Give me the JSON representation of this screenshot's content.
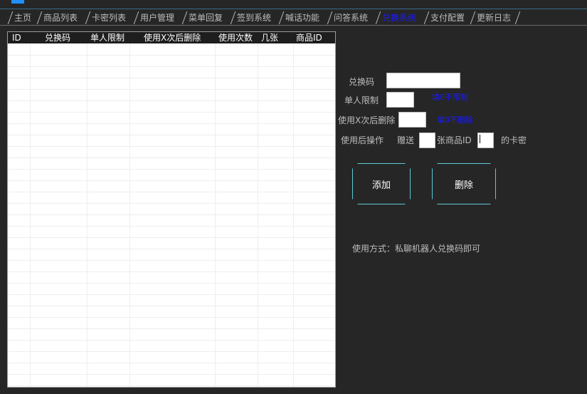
{
  "tabs": [
    {
      "label": "主页"
    },
    {
      "label": "商品列表"
    },
    {
      "label": "卡密列表"
    },
    {
      "label": "用户管理"
    },
    {
      "label": "菜单回复"
    },
    {
      "label": "签到系统"
    },
    {
      "label": "喊话功能"
    },
    {
      "label": "问答系统"
    },
    {
      "label": "兑换系统",
      "active": true
    },
    {
      "label": "支付配置"
    },
    {
      "label": "更新日志"
    }
  ],
  "table": {
    "columns": [
      "ID",
      "兑换码",
      "单人限制",
      "使用X次后删除",
      "使用次数",
      "几张",
      "商品ID"
    ],
    "rows": []
  },
  "form": {
    "code_label": "兑换码",
    "code_value": "",
    "limit_label": "单人限制",
    "limit_value": "",
    "limit_hint": "填0不限制",
    "delete_after_label": "使用X次后删除",
    "delete_after_value": "",
    "delete_after_hint": "填0不删除",
    "after_use_label": "使用后操作",
    "gift_label": "赠送",
    "gift_value": "",
    "goods_label": "张商品ID",
    "goods_value": "",
    "card_label": "的卡密"
  },
  "buttons": {
    "add": "添加",
    "delete": "删除"
  },
  "usage_text": "使用方式：私聊机器人兑换码即可",
  "colors": {
    "background": "#262626",
    "accent": "#5ec8d8",
    "hint": "#1a1aff",
    "active_tab": "#1a1aff"
  }
}
